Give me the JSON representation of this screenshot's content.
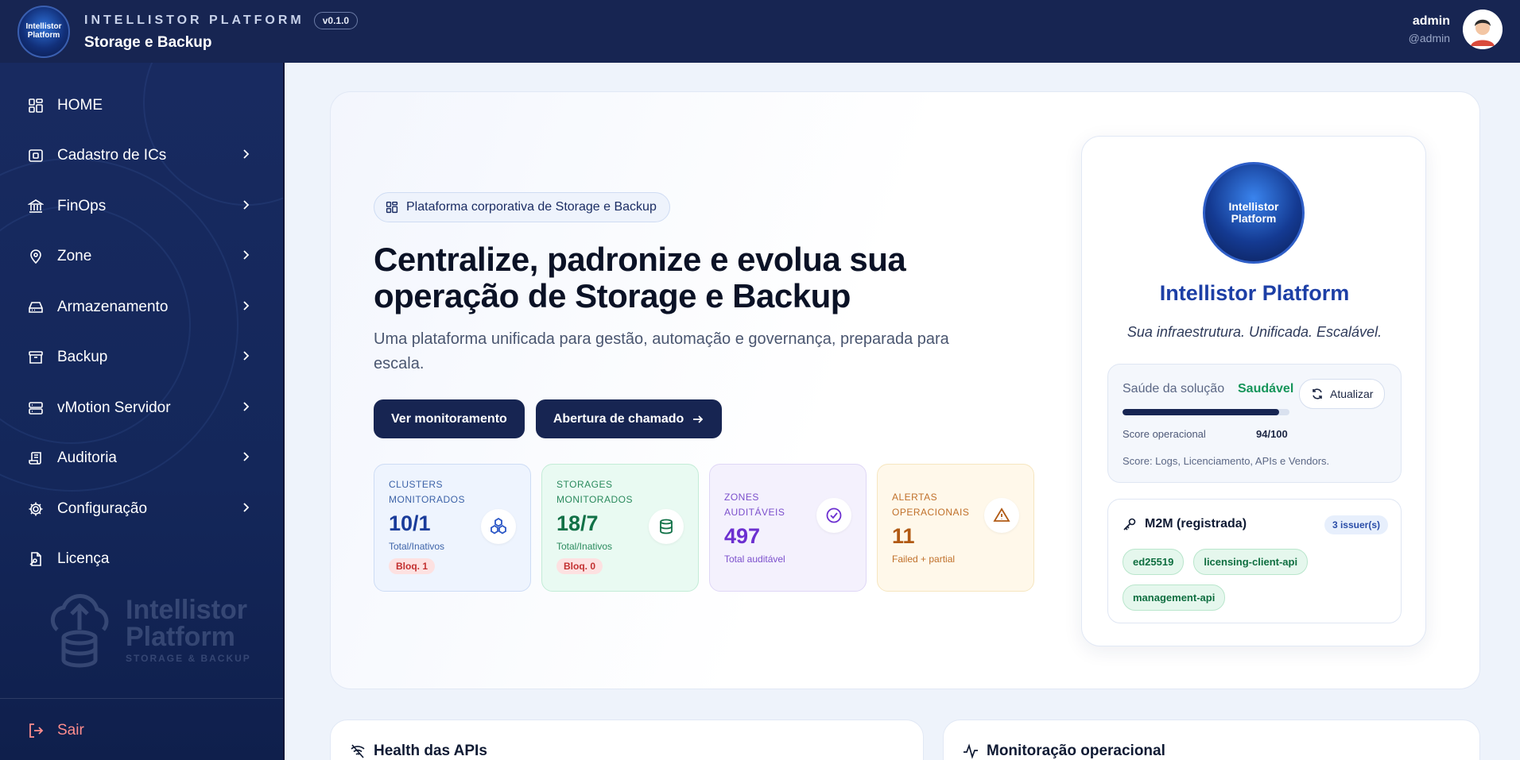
{
  "app": {
    "brand_name": "INTELLISTOR PLATFORM",
    "version": "v0.1.0",
    "section_title": "Storage e Backup",
    "logo_text_1": "Intellistor",
    "logo_text_2": "Platform"
  },
  "user": {
    "name": "admin",
    "handle": "@admin"
  },
  "sidebar": {
    "items": [
      {
        "label": "HOME",
        "icon": "grid-icon",
        "has_submenu": false
      },
      {
        "label": "Cadastro de ICs",
        "icon": "chip-icon",
        "has_submenu": true
      },
      {
        "label": "FinOps",
        "icon": "bank-icon",
        "has_submenu": true
      },
      {
        "label": "Zone",
        "icon": "map-pin-icon",
        "has_submenu": true
      },
      {
        "label": "Armazenamento",
        "icon": "hard-drive-icon",
        "has_submenu": true
      },
      {
        "label": "Backup",
        "icon": "archive-icon",
        "has_submenu": true
      },
      {
        "label": "vMotion Servidor",
        "icon": "server-icon",
        "has_submenu": true
      },
      {
        "label": "Auditoria",
        "icon": "scroll-icon",
        "has_submenu": true
      },
      {
        "label": "Configuração",
        "icon": "gear-icon",
        "has_submenu": true
      },
      {
        "label": "Licença",
        "icon": "license-file-icon",
        "has_submenu": false
      }
    ],
    "watermark": {
      "line1": "Intellistor",
      "line2": "Platform",
      "line3": "STORAGE & BACKUP"
    },
    "logout_label": "Sair"
  },
  "hero": {
    "pill_label": "Plataforma corporativa de Storage e Backup",
    "headline": "Centralize, padronize e evolua sua operação de Storage e Backup",
    "subline": "Uma plataforma unificada para gestão, automação e governança, preparada para escala.",
    "primary_button": "Ver monitoramento",
    "secondary_button": "Abertura de chamado",
    "stats": [
      {
        "label": "CLUSTERS MONITORADOS",
        "value": "10/1",
        "sub": "Total/Inativos",
        "badge": "Bloq. 1",
        "icon": "clusters-icon",
        "tone": "blue"
      },
      {
        "label": "STORAGES MONITORADOS",
        "value": "18/7",
        "sub": "Total/Inativos",
        "badge": "Bloq. 0",
        "icon": "database-icon",
        "tone": "green"
      },
      {
        "label": "ZONES AUDITÁVEIS",
        "value": "497",
        "sub": "Total auditável",
        "badge": "",
        "icon": "check-circle-icon",
        "tone": "purple"
      },
      {
        "label": "ALERTAS OPERACIONAIS",
        "value": "11",
        "sub": "Failed + partial",
        "badge": "",
        "icon": "warning-icon",
        "tone": "orange"
      }
    ]
  },
  "solution_card": {
    "title": "Intellistor Platform",
    "tagline": "Sua infraestrutura. Unificada. Escalável.",
    "logo_text_1": "Intellistor",
    "logo_text_2": "Platform",
    "health": {
      "label": "Saúde da solução",
      "status": "Saudável",
      "status_color": "#16955a",
      "refresh_button": "Atualizar",
      "score_label": "Score operacional",
      "score_value": "94/100",
      "score_fraction": 0.94,
      "note": "Score: Logs, Licenciamento, APIs e Vendors."
    },
    "m2m": {
      "title": "M2M (registrada)",
      "count_badge": "3 issuer(s)",
      "chips": [
        "ed25519",
        "licensing-client-api",
        "management-api"
      ]
    }
  },
  "bottom_cards": {
    "api_health_title": "Health das APIs",
    "monitoring_title": "Monitoração operacional"
  },
  "colors": {
    "topbar": "#172552",
    "sidebar": "#182a60",
    "accent": "#1d3fa6",
    "success": "#16955a",
    "danger": "#c23030"
  }
}
